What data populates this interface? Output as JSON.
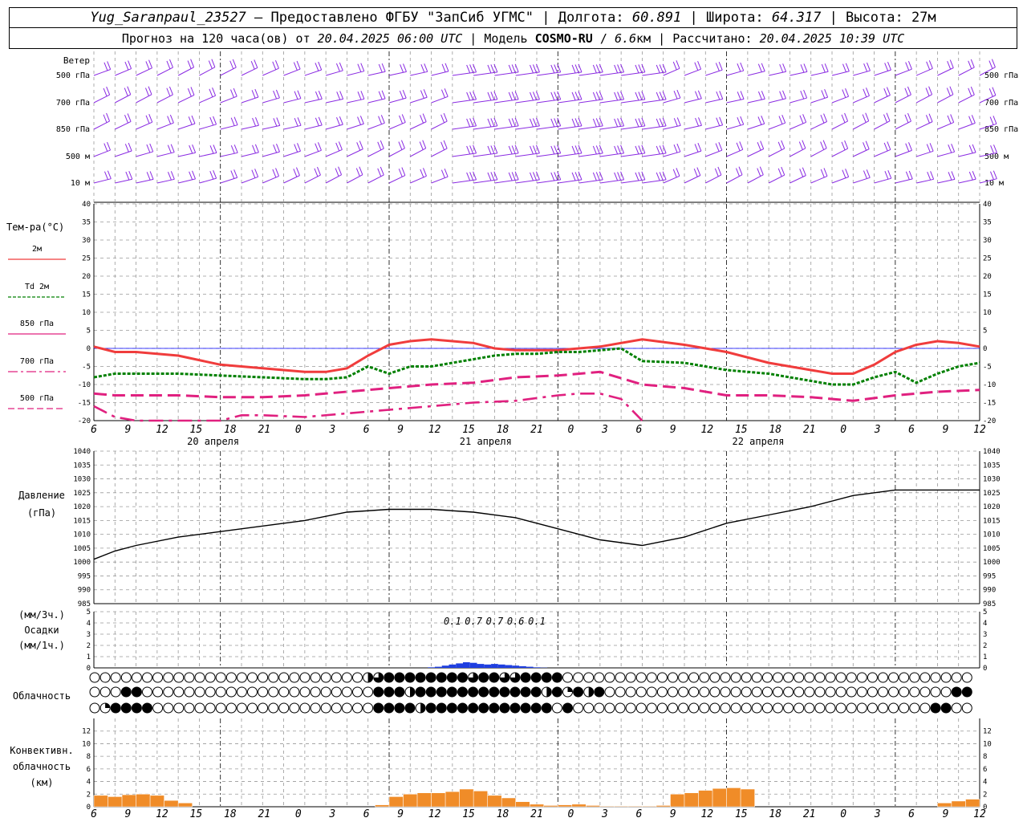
{
  "header": {
    "station": "Yug_Saranpaul_23527",
    "sep_dash": " — ",
    "provider": "Предоставлено ФГБУ \"ЗапСиб УГМС\"",
    "sep1": " | ",
    "lon_label": "Долгота: ",
    "lon_value": "60.891",
    "sep2": " | ",
    "lat_label": "Широта: ",
    "lat_value": "64.317",
    "sep3": " | ",
    "alt_label": "Высота: ",
    "alt_value": "27м",
    "forecast_label": "Прогноз на 120 часа(ов) от ",
    "forecast_start": "20.04.2025 06:00 UTC",
    "model_sep": " | ",
    "model_label": "Модель ",
    "model_name": "COSMO-RU",
    "model_slash": " / ",
    "model_res": "6.6",
    "model_res_unit": "км",
    "calc_sep": " | ",
    "calc_label": "Рассчитано: ",
    "calc_time": "20.04.2025 10:39 UTC"
  },
  "colors": {
    "wind": "#8a2be2",
    "t2m": "#f03c3c",
    "td2m": "#008000",
    "t850": "#e0207f",
    "t700": "#e0207f",
    "t500": "#e0207f",
    "pressure": "#000000",
    "precip": "#1f3fe0",
    "conv": "#f08c28",
    "grid": "#999999",
    "zero_line": "#0000ff"
  },
  "time_axis": {
    "hour_labels": [
      "6",
      "9",
      "12",
      "15",
      "18",
      "21",
      "0",
      "3",
      "6",
      "9",
      "12",
      "15",
      "18",
      "21",
      "0",
      "3",
      "6",
      "9",
      "12",
      "15",
      "18",
      "21",
      "0",
      "3",
      "6",
      "9",
      "12"
    ],
    "date_labels": [
      {
        "text": "20 апреля",
        "hour_index": 2
      },
      {
        "text": "21 апреля",
        "hour_index": 10
      },
      {
        "text": "22 апреля",
        "hour_index": 18
      }
    ]
  },
  "wind_panel": {
    "title": "Ветер",
    "levels": [
      "500 гПа",
      "700 гПа",
      "850 гПа",
      "500 м",
      "10  м"
    ]
  },
  "chart_data": [
    {
      "type": "line",
      "title": "Тем-ра(°C)",
      "x_unit": "hours from 20.04.2025 06 UTC",
      "ylim": [
        -20,
        40
      ],
      "yticks": [
        -20,
        -15,
        -10,
        -5,
        0,
        5,
        10,
        15,
        20,
        25,
        30,
        35,
        40
      ],
      "series": [
        {
          "name": "2м",
          "x": [
            0,
            3,
            6,
            12,
            18,
            24,
            27,
            30,
            33,
            36,
            39,
            42,
            45,
            48,
            51,
            54,
            57,
            60,
            63,
            66,
            69,
            72,
            78,
            84,
            90,
            96,
            99,
            102,
            105,
            108,
            111,
            114,
            117,
            120,
            123,
            126
          ],
          "y": [
            0.5,
            -1,
            -1,
            -2,
            -4.5,
            -5.5,
            -6,
            -6.5,
            -6.5,
            -5.5,
            -2,
            1,
            2,
            2.5,
            2,
            1.5,
            0,
            -0.5,
            -0.5,
            -0.5,
            0,
            0.5,
            2.5,
            1,
            -1,
            -4,
            -5,
            -6,
            -7,
            -7,
            -4.5,
            -1,
            1,
            2,
            1.5,
            0.5
          ]
        },
        {
          "name": "Td 2м",
          "x": [
            0,
            3,
            6,
            12,
            18,
            24,
            30,
            33,
            36,
            39,
            42,
            45,
            48,
            54,
            57,
            60,
            63,
            66,
            69,
            72,
            75,
            78,
            84,
            90,
            96,
            102,
            105,
            108,
            111,
            114,
            117,
            120,
            123,
            126
          ],
          "y": [
            -8,
            -7,
            -7,
            -7,
            -7.5,
            -8,
            -8.5,
            -8.5,
            -8,
            -5,
            -7,
            -5,
            -5,
            -3,
            -2,
            -1.5,
            -1.5,
            -1,
            -1,
            -0.5,
            0,
            -3.5,
            -4,
            -6,
            -7,
            -9,
            -10,
            -10,
            -8,
            -6.5,
            -9.5,
            -7,
            -5,
            -4
          ]
        },
        {
          "name": "850 гПа",
          "x": [
            0,
            3,
            6,
            12,
            18,
            24,
            30,
            36,
            42,
            48,
            54,
            60,
            66,
            72,
            78,
            84,
            90,
            96,
            102,
            108,
            114,
            120,
            126
          ],
          "y": [
            -12.5,
            -13,
            -13,
            -13,
            -13.5,
            -13.5,
            -13,
            -12,
            -11,
            -10,
            -9.5,
            -8,
            -7.5,
            -6.5,
            -10,
            -11,
            -13,
            -13,
            -13.5,
            -14.5,
            -13,
            -12,
            -11.5
          ]
        },
        {
          "name": "700 гПа",
          "x": [
            0,
            3,
            6,
            18,
            21,
            24,
            30,
            36,
            42,
            48,
            54,
            60,
            66,
            69,
            72,
            75,
            78
          ],
          "y": [
            -16,
            -19,
            -20,
            -20,
            -18.5,
            -18.5,
            -19,
            -18,
            -17,
            -16,
            -15,
            -14.5,
            -13,
            -12.5,
            -12.5,
            -14,
            -20
          ]
        },
        {
          "name": "500 гПа",
          "x": [],
          "y": []
        }
      ]
    },
    {
      "type": "line",
      "title": "Давление",
      "units": "(гПа)",
      "ylim": [
        985,
        1040
      ],
      "yticks": [
        985,
        990,
        995,
        1000,
        1005,
        1010,
        1015,
        1020,
        1025,
        1030,
        1035,
        1040
      ],
      "series": [
        {
          "name": "Давление",
          "x": [
            0,
            3,
            6,
            12,
            18,
            24,
            30,
            36,
            42,
            48,
            54,
            60,
            66,
            72,
            78,
            84,
            90,
            96,
            102,
            108,
            114,
            120,
            126
          ],
          "y": [
            1001,
            1004,
            1006,
            1009,
            1011,
            1013,
            1015,
            1018,
            1019,
            1019,
            1018,
            1016,
            1012,
            1008,
            1006,
            1009,
            1014,
            1017,
            1020,
            1024,
            1026,
            1026,
            1026
          ]
        }
      ]
    },
    {
      "type": "bar",
      "title": "Осадки",
      "units_3h": "(мм/3ч.)",
      "units_1h": "(мм/1ч.)",
      "ylim": [
        0,
        5
      ],
      "yticks": [
        0,
        1,
        2,
        3,
        4,
        5
      ],
      "labels": [
        {
          "x": 51,
          "text": "0.1"
        },
        {
          "x": 54,
          "text": "0.7"
        },
        {
          "x": 57,
          "text": "0.7"
        },
        {
          "x": 60,
          "text": "0.6"
        },
        {
          "x": 63,
          "text": "0.1"
        }
      ],
      "x": [
        48,
        49,
        50,
        51,
        52,
        53,
        54,
        55,
        56,
        57,
        58,
        59,
        60,
        61,
        62,
        63,
        64
      ],
      "values": [
        0.05,
        0.1,
        0.2,
        0.3,
        0.4,
        0.5,
        0.45,
        0.35,
        0.3,
        0.35,
        0.3,
        0.25,
        0.2,
        0.15,
        0.1,
        0.05,
        0.02
      ]
    },
    {
      "type": "table",
      "title": "Облачность",
      "legend": "0=clear,1=quarter,2=half,3=three-quarter,4=overcast",
      "rows": [
        [
          0,
          0,
          0,
          0,
          0,
          0,
          0,
          0,
          0,
          0,
          0,
          0,
          0,
          0,
          0,
          0,
          0,
          0,
          0,
          0,
          0,
          0,
          0,
          0,
          0,
          0,
          0,
          0,
          0,
          0,
          0,
          0,
          0,
          0,
          0,
          0,
          0,
          0,
          0,
          0,
          0,
          0,
          0,
          0,
          0,
          0,
          0,
          0,
          0,
          0,
          0,
          0,
          0,
          0,
          0,
          0,
          0,
          0,
          0,
          0,
          0,
          0,
          0,
          0,
          0,
          0,
          0,
          0,
          0,
          0,
          0,
          0,
          0,
          0,
          0,
          0,
          0,
          0,
          0,
          0,
          0,
          0,
          0,
          0,
          0,
          0,
          0,
          0,
          0,
          0,
          0,
          0,
          0,
          0,
          0,
          0,
          0,
          0,
          0,
          0,
          0,
          0,
          0,
          0,
          0,
          0,
          0,
          0,
          0,
          0,
          0,
          0,
          0,
          0,
          0,
          0,
          0,
          0,
          0,
          0,
          0,
          0,
          0,
          0,
          0,
          0,
          0
        ],
        [
          0,
          0,
          0,
          0,
          0,
          0,
          0,
          0,
          0,
          0,
          0,
          0,
          0,
          0,
          0,
          0,
          0,
          0,
          0,
          0,
          0,
          0,
          0,
          0,
          0,
          0,
          0,
          0,
          0,
          0,
          0,
          0,
          0,
          0,
          0,
          0,
          0,
          0,
          0,
          0,
          0,
          0,
          0,
          0,
          0,
          0,
          0,
          0,
          0,
          0,
          0,
          0,
          0,
          0,
          0,
          0,
          0,
          0,
          0,
          0,
          0,
          0,
          0,
          0,
          0,
          0,
          0,
          0,
          0,
          0,
          0,
          0,
          0,
          0,
          0,
          0,
          0,
          0,
          0,
          0,
          0,
          0,
          0,
          0,
          0,
          0,
          0,
          0,
          0,
          0,
          0,
          0,
          0,
          0,
          0,
          0,
          0,
          0,
          0,
          0,
          0,
          0,
          0,
          0,
          0,
          0,
          0,
          0,
          0,
          0,
          0,
          0,
          0,
          0,
          0,
          0,
          0,
          0,
          0,
          0,
          0,
          0,
          0,
          0,
          0,
          0,
          0
        ],
        [
          0,
          0,
          0,
          0,
          0,
          0,
          0,
          0,
          0,
          0,
          0,
          0,
          0,
          0,
          0,
          0,
          0,
          0,
          0,
          0,
          0,
          0,
          0,
          0,
          0,
          0,
          0,
          0,
          0,
          0,
          0,
          0,
          0,
          0,
          0,
          0,
          0,
          0,
          0,
          0,
          0,
          0,
          0,
          0,
          0,
          0,
          0,
          0,
          0,
          0,
          0,
          0,
          0,
          0,
          0,
          0,
          0,
          0,
          0,
          0,
          0,
          0,
          0,
          0,
          0,
          0,
          0,
          0,
          0,
          0,
          0,
          0,
          0,
          0,
          0,
          0,
          0,
          0,
          0,
          0,
          0,
          0,
          0,
          0,
          0,
          0,
          0,
          0,
          0,
          0,
          0,
          0,
          0,
          0,
          0,
          0,
          0,
          0,
          0,
          0,
          0,
          0,
          0,
          0,
          0,
          0,
          0,
          0,
          0,
          0,
          0,
          0,
          0,
          0,
          0,
          0,
          0,
          0,
          0,
          0,
          0,
          0,
          0,
          0,
          0,
          0,
          0
        ]
      ],
      "rows_compact": [
        "000000000000000000000000002344444444344334444000000000000000000000000000000000000000",
        "000440000000000000000000000444244444444444424142400000000000000000000000000000000044",
        "014444000000000000000000000444424444444444440400000000000000000000000000000000004400"
      ]
    },
    {
      "type": "bar",
      "title": "Конвективн. облачность",
      "units": "(км)",
      "ylim": [
        0,
        14
      ],
      "yticks": [
        0,
        2,
        4,
        6,
        8,
        10,
        12
      ],
      "x": [
        1,
        3,
        5,
        7,
        9,
        11,
        13,
        15,
        17,
        19,
        21,
        23,
        25,
        27,
        29,
        31,
        33,
        35,
        37,
        39,
        41,
        43,
        45,
        47,
        49,
        51,
        53,
        55,
        57,
        59,
        61,
        63,
        65,
        67,
        69,
        71,
        73,
        75,
        77,
        79,
        81,
        83,
        85,
        87,
        89,
        91,
        93,
        95,
        97,
        99,
        101,
        103,
        105,
        107,
        109,
        111,
        113,
        115,
        117,
        119,
        121,
        123,
        125
      ],
      "values": [
        1.8,
        1.6,
        1.9,
        2,
        1.8,
        1,
        0.6,
        0,
        0,
        0,
        0,
        0,
        0,
        0,
        0,
        0,
        0,
        0,
        0,
        0,
        0.3,
        1.6,
        2,
        2.2,
        2.2,
        2.4,
        2.8,
        2.5,
        1.8,
        1.4,
        0.8,
        0.4,
        0.2,
        0.3,
        0.4,
        0.2,
        0.1,
        0.1,
        0.1,
        0.1,
        0.2,
        2,
        2.2,
        2.6,
        2.9,
        3,
        2.8,
        0,
        0,
        0,
        0,
        0,
        0,
        0,
        0,
        0,
        0,
        0,
        0,
        0,
        0.6,
        0.9,
        1.2,
        1.8,
        2.2,
        2.9,
        2.2
      ]
    }
  ]
}
